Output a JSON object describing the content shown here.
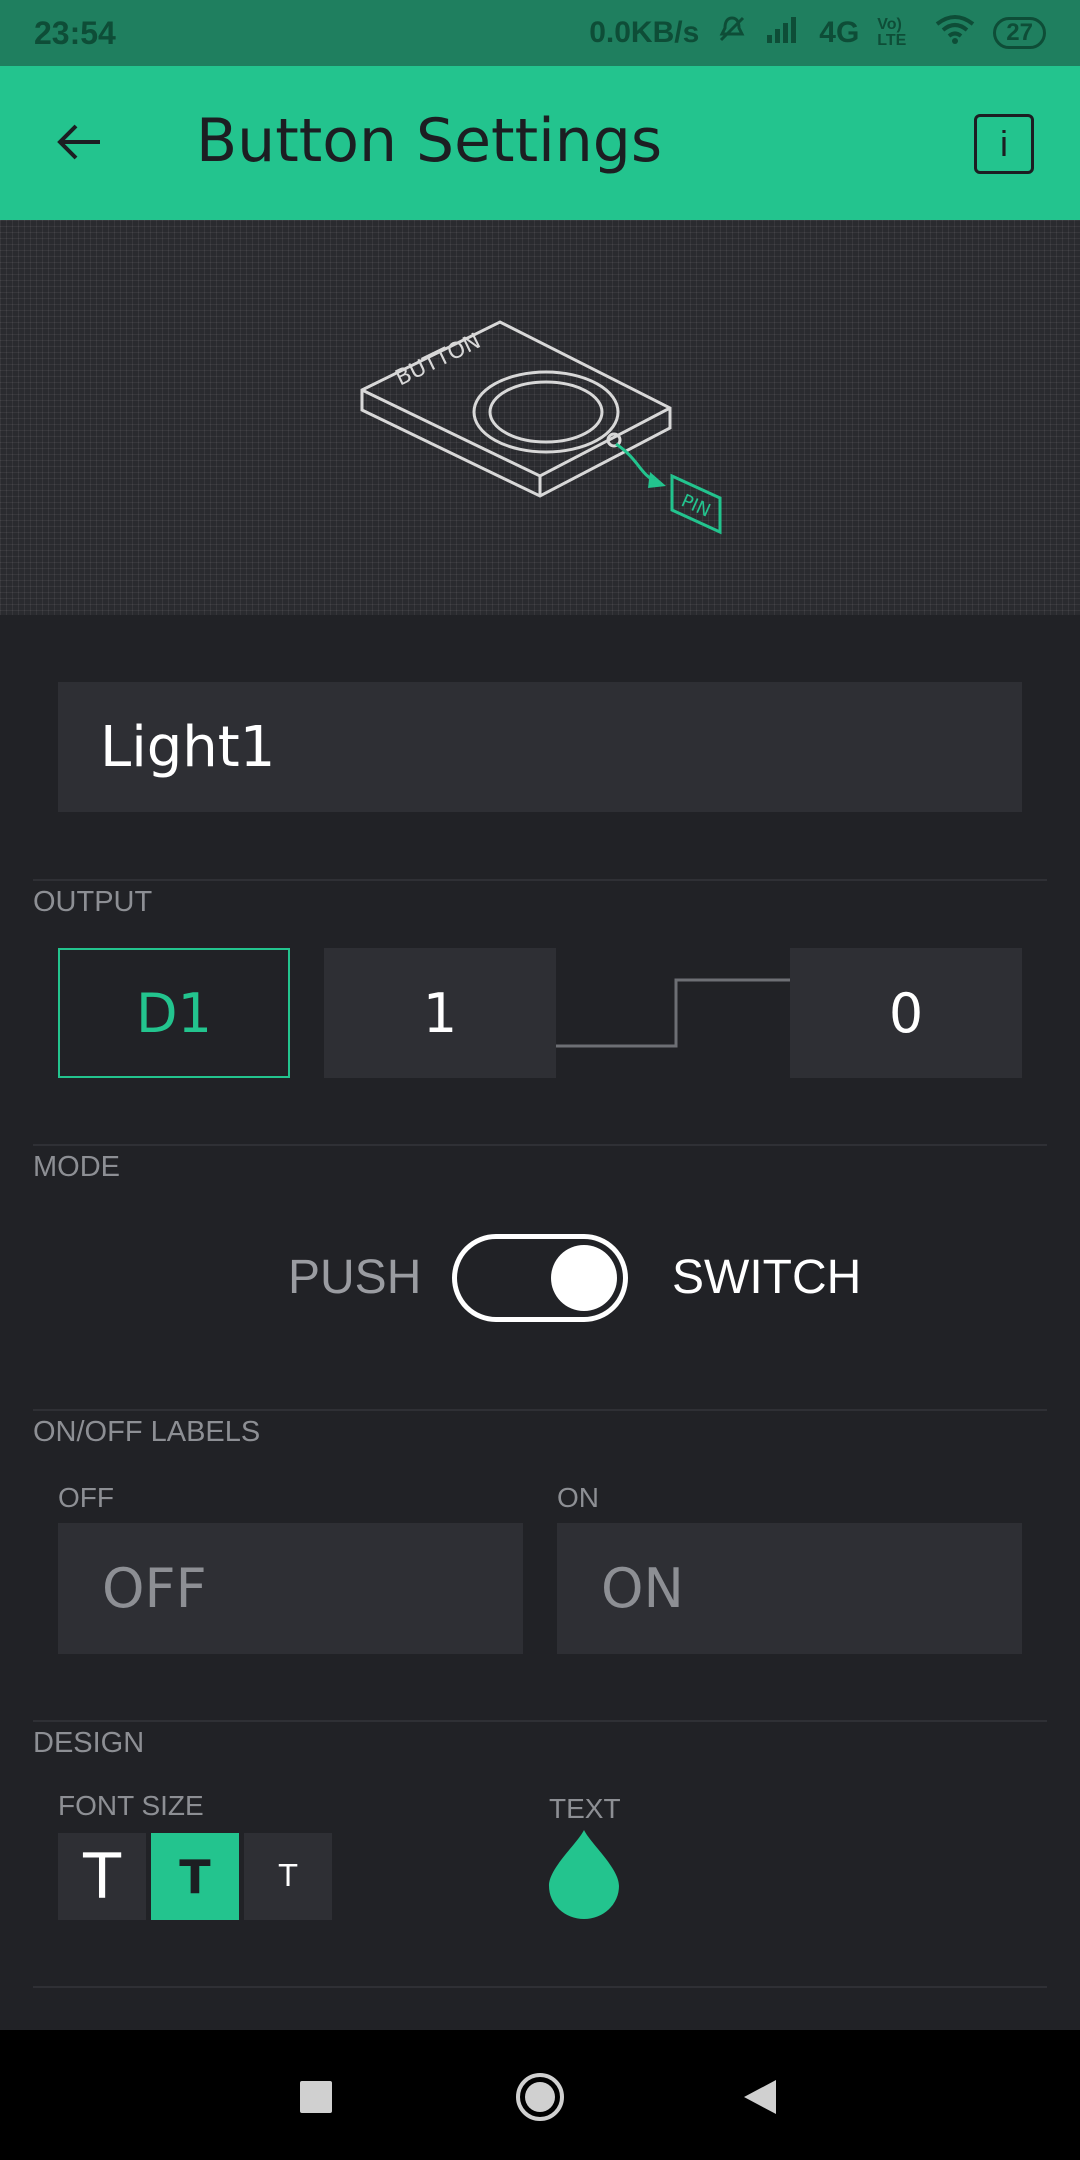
{
  "status_bar": {
    "time": "23:54",
    "net_speed": "0.0KB/s",
    "network": "4G",
    "volte": "Vo) LTE",
    "battery": "27"
  },
  "app_bar": {
    "title": "Button Settings",
    "info_label": "i"
  },
  "illustration": {
    "device_label": "BUTTON",
    "pin_label": "PIN"
  },
  "name_field": {
    "value": "Light1"
  },
  "output": {
    "section_label": "OUTPUT",
    "pin": "D1",
    "high_value": "1",
    "low_value": "0"
  },
  "mode": {
    "section_label": "MODE",
    "left_label": "PUSH",
    "right_label": "SWITCH",
    "selected": "SWITCH"
  },
  "labels": {
    "section_label": "ON/OFF LABELS",
    "off_caption": "OFF",
    "off_value": "OFF",
    "on_caption": "ON",
    "on_value": "ON"
  },
  "design": {
    "section_label": "DESIGN",
    "font_size_caption": "FONT SIZE",
    "font_sizes": [
      "T",
      "T",
      "T"
    ],
    "selected_font_size": 1,
    "text_caption": "TEXT",
    "text_color": "#23c48e"
  },
  "colors": {
    "accent": "#23c48e",
    "background": "#212226",
    "field": "#2e2f34"
  }
}
